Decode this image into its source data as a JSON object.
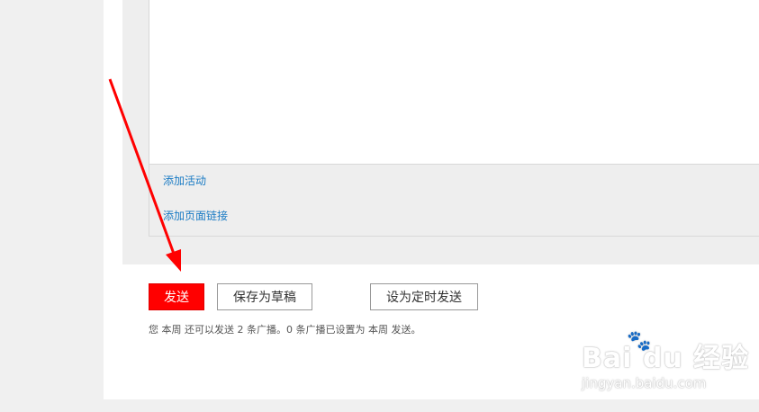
{
  "editor": {
    "add_activity_link": "添加活动",
    "add_page_link": "添加页面链接"
  },
  "actions": {
    "send_label": "发送",
    "save_draft_label": "保存为草稿",
    "schedule_label": "设为定时发送"
  },
  "quota_text": "您 本周 还可以发送 2 条广播。0 条广播已设置为 本周 发送。",
  "colors": {
    "primary": "#ff0000",
    "link": "#1a7bc4",
    "arrow": "#ff0000"
  },
  "watermark": {
    "brand": "Bai du 经验",
    "url": "jingyan.baidu.com",
    "icon": "paw-icon"
  }
}
